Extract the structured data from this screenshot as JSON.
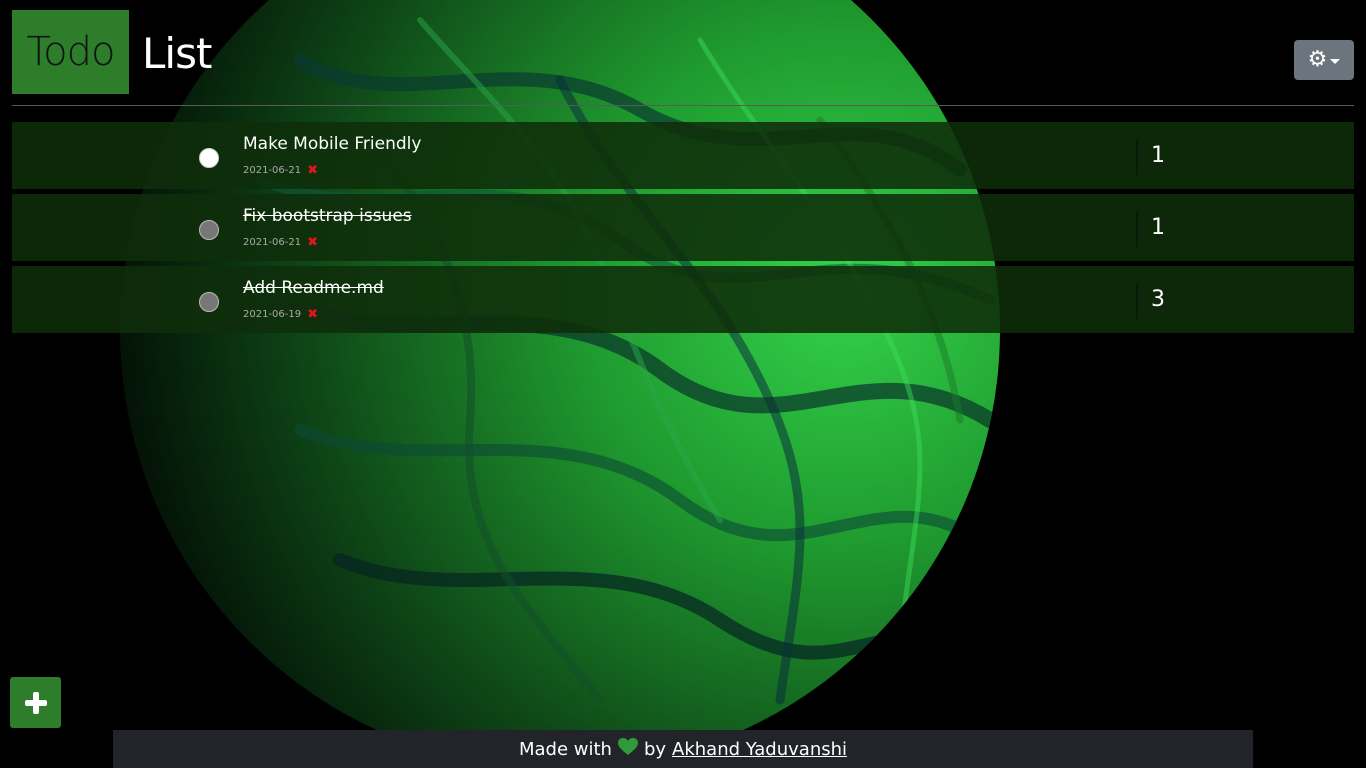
{
  "header": {
    "logo_part1": "Todo",
    "logo_part2": "List",
    "settings_icon": "gear-icon"
  },
  "todos": [
    {
      "title": "Make Mobile Friendly",
      "date": "2021-06-21",
      "count": "1",
      "completed": false
    },
    {
      "title": "Fix bootstrap issues",
      "date": "2021-06-21",
      "count": "1",
      "completed": true
    },
    {
      "title": "Add Readme.md",
      "date": "2021-06-19",
      "count": "3",
      "completed": true
    }
  ],
  "add_button": {
    "icon": "plus-icon"
  },
  "footer": {
    "prefix": "Made with",
    "middle": "by",
    "author": "Akhand Yaduvanshi"
  },
  "colors": {
    "accent": "#2e7d2b",
    "delete": "#e3151a",
    "settings": "#6c757d",
    "footer_bg": "#212529"
  }
}
